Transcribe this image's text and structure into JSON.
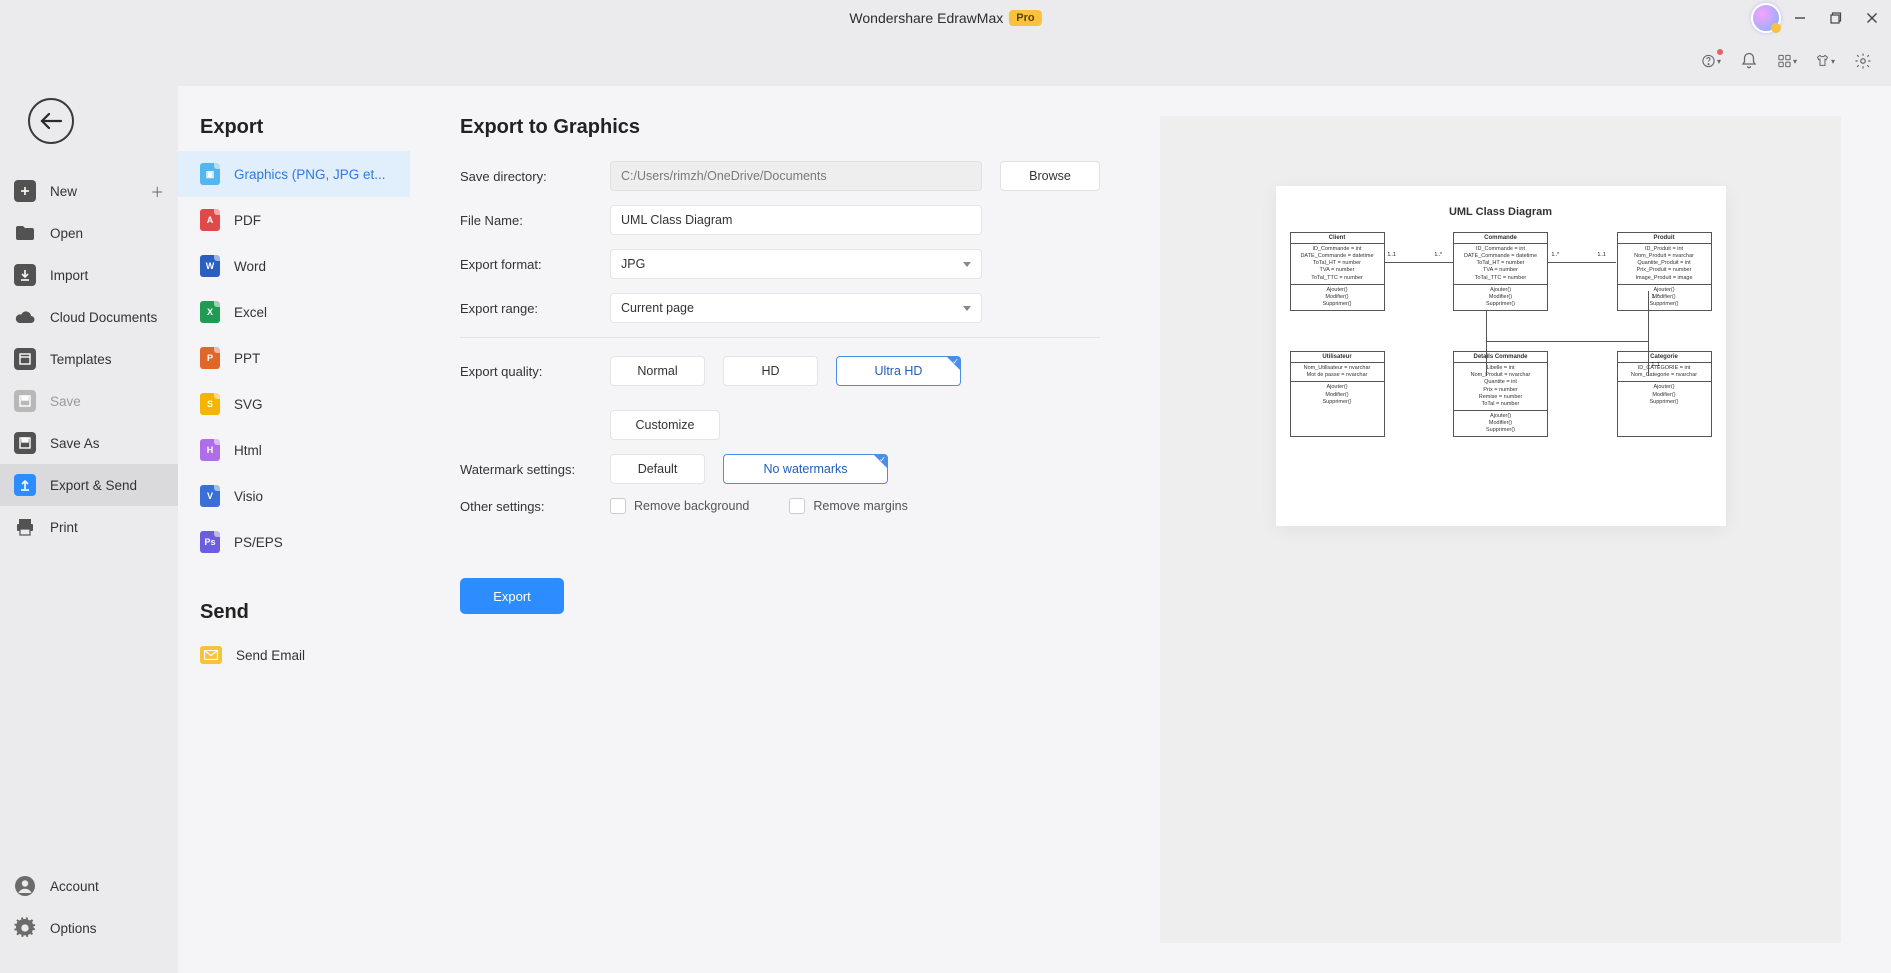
{
  "titlebar": {
    "app_name": "Wondershare EdrawMax",
    "pro_badge": "Pro"
  },
  "nav_primary": {
    "items": [
      {
        "label": "New",
        "has_plus": true
      },
      {
        "label": "Open"
      },
      {
        "label": "Import"
      },
      {
        "label": "Cloud Documents"
      },
      {
        "label": "Templates"
      },
      {
        "label": "Save",
        "disabled": true
      },
      {
        "label": "Save As"
      },
      {
        "label": "Export & Send",
        "selected": true
      },
      {
        "label": "Print"
      }
    ],
    "bottom": [
      {
        "label": "Account"
      },
      {
        "label": "Options"
      }
    ]
  },
  "nav_secondary": {
    "heading": "Export",
    "items": [
      {
        "label": "Graphics (PNG, JPG et...",
        "color": "#53b6ef",
        "selected": true
      },
      {
        "label": "PDF",
        "color": "#e14848"
      },
      {
        "label": "Word",
        "color": "#2a5fc1"
      },
      {
        "label": "Excel",
        "color": "#1f9b54"
      },
      {
        "label": "PPT",
        "color": "#e0662a"
      },
      {
        "label": "SVG",
        "color": "#f4b400"
      },
      {
        "label": "Html",
        "color": "#b06de8"
      },
      {
        "label": "Visio",
        "color": "#3a6fd6"
      },
      {
        "label": "PS/EPS",
        "color": "#6b5de0"
      }
    ],
    "send_heading": "Send",
    "send_items": [
      {
        "label": "Send Email"
      }
    ]
  },
  "form": {
    "title": "Export to Graphics",
    "save_dir_label": "Save directory:",
    "save_dir_value": "C:/Users/rimzh/OneDrive/Documents",
    "browse_label": "Browse",
    "file_name_label": "File Name:",
    "file_name_value": "UML Class Diagram",
    "format_label": "Export format:",
    "format_value": "JPG",
    "range_label": "Export range:",
    "range_value": "Current page",
    "quality_label": "Export quality:",
    "quality_options": {
      "normal": "Normal",
      "hd": "HD",
      "ultra": "Ultra HD"
    },
    "customize_label": "Customize",
    "watermark_label": "Watermark settings:",
    "watermark_options": {
      "default": "Default",
      "none": "No watermarks"
    },
    "other_label": "Other settings:",
    "remove_bg": "Remove background",
    "remove_margins": "Remove margins",
    "export_button": "Export"
  },
  "preview": {
    "title": "UML Class Diagram",
    "boxes_row1": [
      {
        "name": "Client",
        "attrs": "ID_Commande = int\nDATE_Commande = datetime\nToTal_HT = number\nTVA = number\nToTal_TTC = number",
        "ops": "Ajouter()\nModifier()\nSupprimer()"
      },
      {
        "name": "Commande",
        "attrs": "ID_Commande = int\nDATE_Commande = datetime\nToTal_HT = number\nTVA = number\nToTal_TTC = number",
        "ops": "Ajouter()\nModifier()\nSupprimer()"
      },
      {
        "name": "Produit",
        "attrs": "ID_Produit = int\nNom_Produit = nvarchar\nQuantite_Produit = int\nPrix_Produit = number\nImage_Produit = image",
        "ops": "Ajouter()\nModifier()\nSupprimer()"
      }
    ],
    "boxes_row2": [
      {
        "name": "Utilisateur",
        "attrs": "Nom_Utilisateur = nvarchar\nMot de passe = nvarchar",
        "ops": "Ajouter()\nModifier()\nSupprimer()"
      },
      {
        "name": "Details Commande",
        "attrs": "Libelle = int\nNom_Produit = nvarchar\nQuantite = int\nPrix = number\nRemise = number\nToTal = number",
        "ops": "Ajouter()\nModifier()\nSupprimer()"
      },
      {
        "name": "Categorie",
        "attrs": "ID_CATEGORIE = int\nNom_Categorie = nvarchar",
        "ops": "Ajouter()\nModifier()\nSupprimer()"
      }
    ],
    "multiplicity": [
      "1..1",
      "1..*",
      "1..*",
      "1..1",
      "1..1",
      "1..*"
    ]
  }
}
